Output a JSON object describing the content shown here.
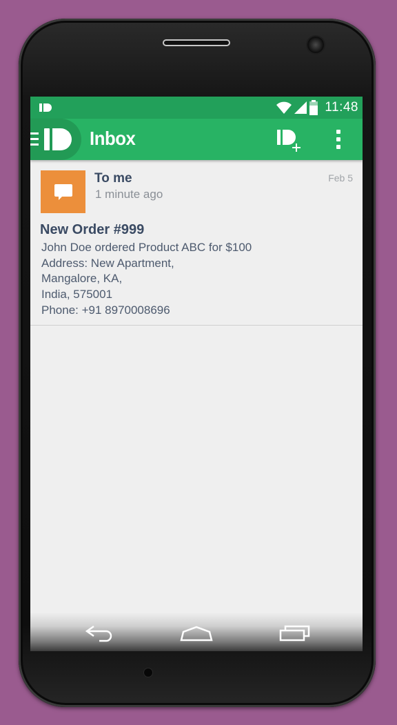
{
  "status_bar": {
    "time": "11:48",
    "icons": [
      "pushbullet-icon",
      "wifi-icon",
      "cell-signal-icon",
      "battery-icon"
    ]
  },
  "app_bar": {
    "title": "Inbox",
    "icons": [
      "menu-icon",
      "pushbullet-logo-icon",
      "compose-push-icon",
      "overflow-menu-icon"
    ],
    "accent_color": "#28b364",
    "status_color": "#22a05a"
  },
  "messages": [
    {
      "sender": "To me",
      "relative_time": "1 minute ago",
      "date": "Feb 5",
      "avatar_icon": "chat-bubble-icon",
      "avatar_color": "#ec8f3b",
      "title": "New Order #999",
      "body_lines": [
        "John Doe ordered Product ABC for $100",
        "Address: New Apartment,",
        "Mangalore, KA,",
        "India, 575001",
        "Phone: +91 8970008696"
      ]
    }
  ],
  "nav_bar": {
    "buttons": [
      "back-icon",
      "home-icon",
      "recents-icon"
    ]
  },
  "colors": {
    "background": "#9a5b8f",
    "screen": "#efefef",
    "text_primary": "#3a4a63"
  }
}
